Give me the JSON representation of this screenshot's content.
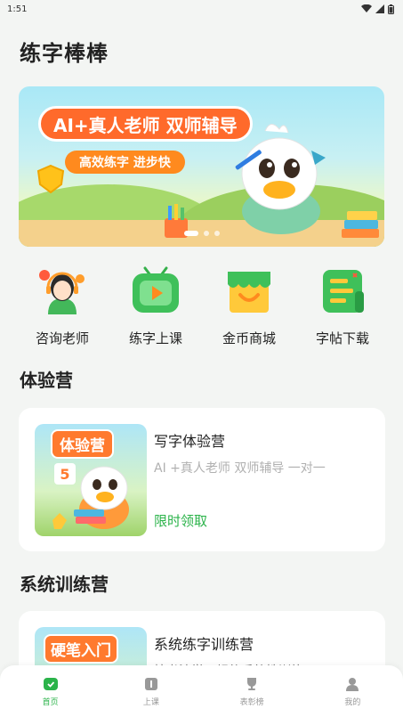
{
  "status": {
    "time": "1:51"
  },
  "app": {
    "title": "练字棒棒"
  },
  "banner": {
    "headline": "AI+真人老师 双师辅导",
    "subline": "高效练字 进步快",
    "pages": 3,
    "active_page": 1
  },
  "quick_menu": [
    {
      "label": "咨询老师",
      "icon": "teacher-headset-icon"
    },
    {
      "label": "练字上课",
      "icon": "tv-play-icon"
    },
    {
      "label": "金币商城",
      "icon": "shop-icon"
    },
    {
      "label": "字帖下载",
      "icon": "notes-icon"
    }
  ],
  "trial_section": {
    "title": "体验营",
    "card": {
      "thumb_text": "体验营",
      "thumb_badge": "5",
      "title": "写字体验营",
      "desc": "AI +真人老师 双师辅导 一对一",
      "cta": "限时领取"
    }
  },
  "system_section": {
    "title": "系统训练营",
    "card": {
      "thumb_text": "硬笔入门",
      "title": "系统练字训练营",
      "desc": "按书法学习规律系统性训练"
    }
  },
  "bottom_nav": [
    {
      "label": "首页",
      "icon": "home-icon",
      "active": true
    },
    {
      "label": "上课",
      "icon": "class-icon",
      "active": false
    },
    {
      "label": "表彰榜",
      "icon": "trophy-icon",
      "active": false
    },
    {
      "label": "我的",
      "icon": "profile-icon",
      "active": false
    }
  ],
  "colors": {
    "accent": "#2bb34a",
    "banner_orange": "#ff6a2b",
    "background": "#f3f5f3"
  }
}
